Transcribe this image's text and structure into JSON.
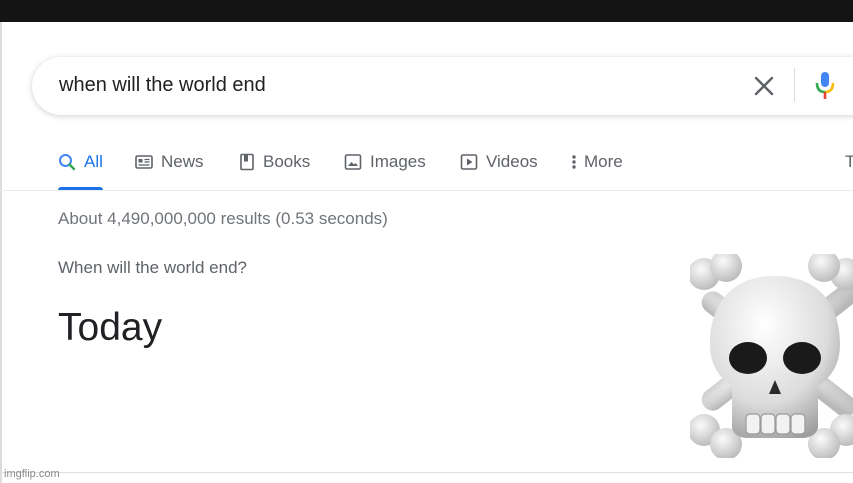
{
  "search": {
    "query": "when will the world end",
    "clear_icon": "close-icon",
    "voice_icon": "microphone-icon"
  },
  "tabs": [
    {
      "label": "All",
      "icon": "search-icon",
      "active": true
    },
    {
      "label": "News",
      "icon": "newspaper-icon"
    },
    {
      "label": "Books",
      "icon": "book-icon"
    },
    {
      "label": "Images",
      "icon": "image-icon"
    },
    {
      "label": "Videos",
      "icon": "play-icon"
    },
    {
      "label": "More",
      "icon": "more-vert-icon"
    },
    {
      "label": "T"
    }
  ],
  "results": {
    "stats": "About 4,490,000,000 results (0.53 seconds)",
    "question": "When will the world end?",
    "answer": "Today"
  },
  "image": {
    "icon": "skull-and-crossbones-icon"
  },
  "watermark": "imgflip.com",
  "colors": {
    "accent": "#1a73e8",
    "text_primary": "#202124",
    "text_secondary": "#70757a",
    "top_bar": "#141414"
  }
}
